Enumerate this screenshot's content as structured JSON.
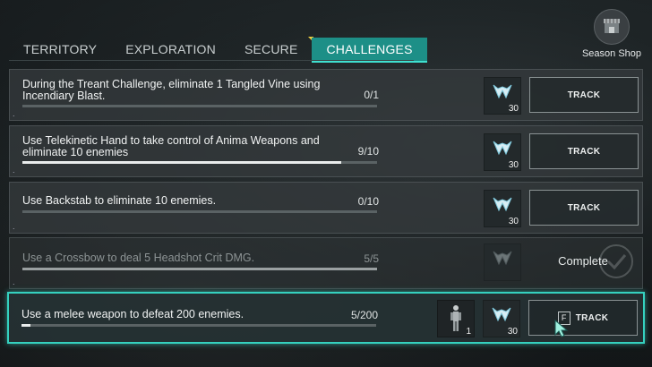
{
  "season_shop": {
    "label": "Season Shop"
  },
  "tabs": [
    {
      "label": "TERRITORY"
    },
    {
      "label": "EXPLORATION"
    },
    {
      "label": "SECURE"
    },
    {
      "label": "CHALLENGES"
    }
  ],
  "active_tab": "CHALLENGES",
  "challenges": [
    {
      "description": "During the Treant Challenge, eliminate 1 Tangled Vine using Incendiary Blast.",
      "progress_text": "0/1",
      "progress": 0.0,
      "reward_qty": "30",
      "action_label": "TRACK"
    },
    {
      "description": "Use Telekinetic Hand to take control of Anima Weapons and eliminate 10 enemies",
      "progress_text": "9/10",
      "progress": 0.9,
      "reward_qty": "30",
      "action_label": "TRACK"
    },
    {
      "description": "Use Backstab to eliminate 10 enemies.",
      "progress_text": "0/10",
      "progress": 0.0,
      "reward_qty": "30",
      "action_label": "TRACK"
    },
    {
      "description": "Use a Crossbow to deal 5 Headshot Crit DMG.",
      "progress_text": "5/5",
      "progress": 1.0,
      "reward_qty": "",
      "status_label": "Complete"
    },
    {
      "description": "Use a melee weapon to defeat 200 enemies.",
      "progress_text": "5/200",
      "progress": 0.025,
      "extra_reward_qty": "1",
      "reward_qty": "30",
      "action_key": "F",
      "action_label": "TRACK"
    }
  ],
  "colors": {
    "accent": "#1d8f87",
    "highlight": "#35d1bf"
  }
}
